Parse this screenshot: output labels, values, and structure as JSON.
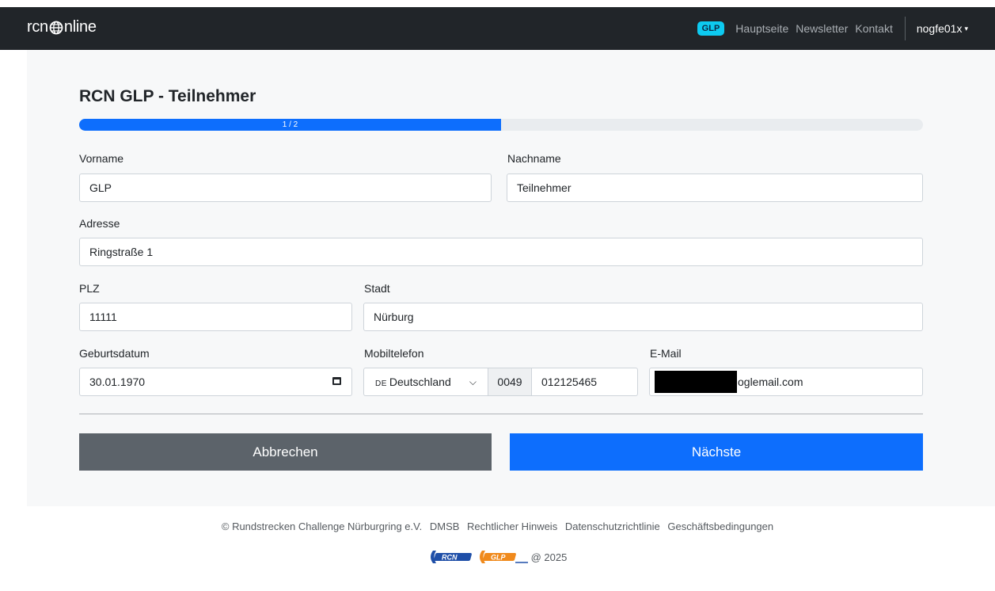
{
  "navbar": {
    "brand_text": "rcnonline",
    "brand_prefix": "rcn",
    "brand_suffix": "nline",
    "badge": "GLP",
    "links": [
      "Hauptseite",
      "Newsletter",
      "Kontakt"
    ],
    "user": "nogfe01x",
    "icons": {
      "brand": "globe-icon",
      "user_menu": "caret-down-icon"
    }
  },
  "form": {
    "title": "RCN GLP - Teilnehmer",
    "progress": {
      "label": "1 / 2",
      "current": 1,
      "total": 2
    },
    "fields": {
      "vorname": {
        "label": "Vorname",
        "value": "GLP"
      },
      "nachname": {
        "label": "Nachname",
        "value": "Teilnehmer"
      },
      "adresse": {
        "label": "Adresse",
        "value": "Ringstraße 1"
      },
      "plz": {
        "label": "PLZ",
        "value": "11111"
      },
      "stadt": {
        "label": "Stadt",
        "value": "Nürburg"
      },
      "geburtsdatum": {
        "label": "Geburtsdatum",
        "value": "30.01.1970"
      },
      "mobiltelefon": {
        "label": "Mobiltelefon",
        "country_code": "DE",
        "country": "Deutschland",
        "prefix": "0049",
        "number": "012125465"
      },
      "email": {
        "label": "E-Mail",
        "value_visible": "oglemail.com"
      }
    },
    "buttons": {
      "cancel": "Abbrechen",
      "next": "Nächste"
    }
  },
  "footer": {
    "copyright": "© Rundstrecken Challenge Nürburgring e.V.",
    "links": [
      "DMSB",
      "Rechtlicher Hinweis",
      "Datenschutzrichtlinie",
      "Geschäftsbedingungen"
    ],
    "year_text": "@ 2025",
    "logos": [
      "RCN",
      "GLP"
    ]
  },
  "colors": {
    "navbar": "#212529",
    "primary": "#0d6efd",
    "secondary": "#5c636a",
    "badge": "#0dcaf0",
    "logo_blue": "#1f4fa8",
    "logo_orange": "#f08a1c"
  }
}
